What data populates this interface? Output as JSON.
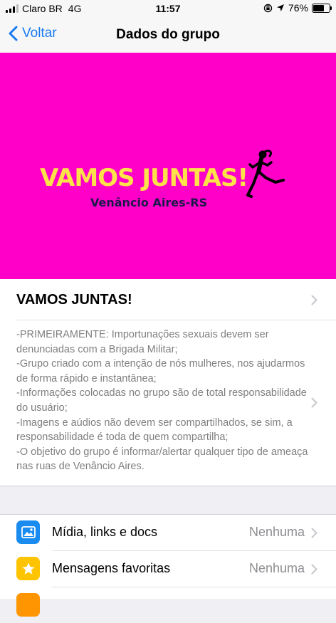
{
  "status_bar": {
    "carrier": "Claro BR",
    "network": "4G",
    "time": "11:57",
    "battery": "76%",
    "battery_level": 0.76,
    "signal_bars_filled": 3,
    "signal_bars_total": 4
  },
  "nav": {
    "back_label": "Voltar",
    "title": "Dados do grupo"
  },
  "banner": {
    "background_color": "#ff00c8",
    "title": "VAMOS JUNTAS!",
    "subtitle": "Venâncio Aires-RS",
    "title_color": "#ffe24a",
    "camera_icon": "camera-icon"
  },
  "group": {
    "name": "VAMOS JUNTAS!",
    "description": [
      "-PRIMEIRAMENTE: Importunações sexuais devem ser denunciadas com a Brigada Militar;",
      "-Grupo criado com a intenção de nós mulheres, nos ajudarmos de forma rápido e instantânea;",
      "-Informações colocadas no grupo são de total responsabilidade do usuário;",
      "-Imagens e aúdios não devem ser compartilhados, se sim, a responsabilidade é toda de quem compartilha;",
      "-O objetivo do grupo é informar/alertar qualquer tipo de ameaça nas ruas de Venâncio Aires."
    ]
  },
  "menu": [
    {
      "label": "Mídia, links e docs",
      "value": "Nenhuma",
      "icon": "photo-icon",
      "color": "#1a8cf0"
    },
    {
      "label": "Mensagens favoritas",
      "value": "Nenhuma",
      "icon": "star-icon",
      "color": "#ffc400"
    },
    {
      "icon": "partial-icon",
      "color": "#ff9500"
    }
  ],
  "colors": {
    "accent": "#1a7bf0",
    "secondary_text": "#8e8e93"
  }
}
